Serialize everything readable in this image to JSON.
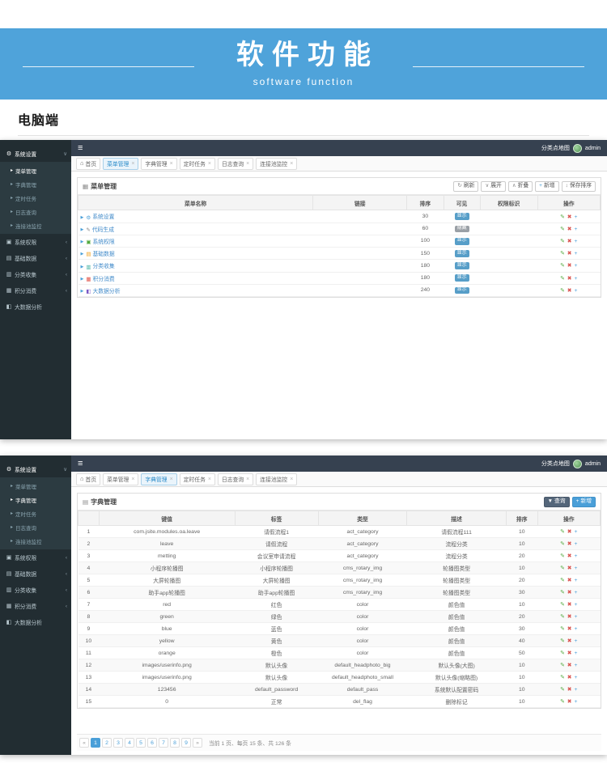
{
  "banner": {
    "title": "软件功能",
    "subtitle": "software function"
  },
  "section_label": "电脑端",
  "colors": {
    "accent": "#4a9fd8",
    "banner": "#4fa3da",
    "sidebar": "#222d32",
    "navbar": "#364150",
    "badge_show": "#579ec8",
    "badge_hide": "#9aa0a6"
  },
  "icons": {
    "hamburger": "≡",
    "home": "⌂",
    "close": "×",
    "caret_right": "▸",
    "chevron_down": "∨",
    "tree": "▶",
    "edit": "✎",
    "delete": "✖",
    "add": "+",
    "box_title1": "▦",
    "box_title2": "▤"
  },
  "navbar": {
    "map_link": "分类点地图",
    "user": "admin"
  },
  "sidebar": {
    "items": [
      {
        "label": "系统设置",
        "glyph": "⚙",
        "icon": "gear-icon",
        "expanded": true,
        "children": [
          "菜单管理",
          "字典管理",
          "定时任务",
          "日志查询",
          "连接池监控"
        ]
      },
      {
        "label": "系统权限",
        "glyph": "▣",
        "icon": "permission-icon",
        "arrow": "‹"
      },
      {
        "label": "基础数据",
        "glyph": "▤",
        "icon": "database-icon",
        "arrow": "‹"
      },
      {
        "label": "分类收集",
        "glyph": "▥",
        "icon": "collect-icon",
        "arrow": "‹"
      },
      {
        "label": "积分消费",
        "glyph": "▦",
        "icon": "points-icon",
        "arrow": "‹"
      },
      {
        "label": "大数据分析",
        "glyph": "◧",
        "icon": "analysis-icon",
        "arrow": ""
      }
    ]
  },
  "tabs": [
    {
      "label": "首页",
      "home": true
    },
    {
      "label": "菜单管理"
    },
    {
      "label": "字典管理"
    },
    {
      "label": "定时任务"
    },
    {
      "label": "日志查询"
    },
    {
      "label": "连接池监控"
    }
  ],
  "panel1": {
    "active_tab": "菜单管理",
    "active_side": "菜单管理",
    "box_title": "菜单管理",
    "toolbar": [
      {
        "label": "刷新",
        "glyph": "↻",
        "icon": "refresh-icon",
        "name": "refresh-button",
        "style": "default"
      },
      {
        "label": "展开",
        "glyph": "∨",
        "icon": "expand-icon",
        "name": "expand-button",
        "style": "default"
      },
      {
        "label": "折叠",
        "glyph": "∧",
        "icon": "collapse-icon",
        "name": "collapse-button",
        "style": "default"
      },
      {
        "label": "新增",
        "glyph": "+",
        "icon": "plus-icon",
        "name": "add-button",
        "style": "default",
        "icon_color": "#4a9fd8"
      },
      {
        "label": "保存排序",
        "glyph": "↕",
        "icon": "sort-icon",
        "name": "save-sort-button",
        "style": "default"
      }
    ],
    "headers": [
      "菜单名称",
      "链接",
      "排序",
      "可见",
      "权限标识",
      "操作"
    ],
    "rows": [
      {
        "name": "系统设置",
        "glyph": "⚙",
        "color": "#4a9fd8",
        "link": "",
        "sort": "30",
        "visible": "显示",
        "show": true,
        "perm": ""
      },
      {
        "name": "代码生成",
        "glyph": "✎",
        "color": "#8a8a8a",
        "link": "",
        "sort": "60",
        "visible": "隐藏",
        "show": false,
        "perm": ""
      },
      {
        "name": "系统权限",
        "glyph": "▣",
        "color": "#53a93f",
        "link": "",
        "sort": "100",
        "visible": "显示",
        "show": true,
        "perm": ""
      },
      {
        "name": "基础数据",
        "glyph": "▤",
        "color": "#f4a425",
        "link": "",
        "sort": "150",
        "visible": "显示",
        "show": true,
        "perm": ""
      },
      {
        "name": "分类收集",
        "glyph": "▥",
        "color": "#3bafa0",
        "link": "",
        "sort": "180",
        "visible": "显示",
        "show": true,
        "perm": ""
      },
      {
        "name": "积分消费",
        "glyph": "▦",
        "color": "#e2574c",
        "link": "",
        "sort": "180",
        "visible": "显示",
        "show": true,
        "perm": ""
      },
      {
        "name": "大数据分析",
        "glyph": "◧",
        "color": "#7a57c5",
        "link": "",
        "sort": "240",
        "visible": "显示",
        "show": true,
        "perm": ""
      }
    ]
  },
  "panel2": {
    "active_tab": "字典管理",
    "active_side": "字典管理",
    "box_title": "字典管理",
    "toolbar": [
      {
        "label": "查询",
        "glyph": "▼",
        "icon": "filter-icon",
        "name": "query-button",
        "style": "dark"
      },
      {
        "label": "新增",
        "glyph": "+",
        "icon": "plus-icon",
        "name": "add-button",
        "style": "primary"
      }
    ],
    "headers": [
      "",
      "键值",
      "标签",
      "类型",
      "描述",
      "排序",
      "操作"
    ],
    "rows": [
      [
        "1",
        "com.jsite.modules.oa.leave",
        "请假流程1",
        "act_category",
        "请假流程111",
        "10"
      ],
      [
        "2",
        "leave",
        "请假流程",
        "act_category",
        "流程分类",
        "10"
      ],
      [
        "3",
        "metting",
        "会议室申请流程",
        "act_category",
        "流程分类",
        "20"
      ],
      [
        "4",
        "小程序轮播图",
        "小程序轮播图",
        "cms_rotary_img",
        "轮播图类型",
        "10"
      ],
      [
        "5",
        "大屏轮播图",
        "大屏轮播图",
        "cms_rotary_img",
        "轮播图类型",
        "20"
      ],
      [
        "6",
        "助手app轮播图",
        "助手app轮播图",
        "cms_rotary_img",
        "轮播图类型",
        "30"
      ],
      [
        "7",
        "red",
        "红色",
        "color",
        "颜色值",
        "10"
      ],
      [
        "8",
        "green",
        "绿色",
        "color",
        "颜色值",
        "20"
      ],
      [
        "9",
        "blue",
        "蓝色",
        "color",
        "颜色值",
        "30"
      ],
      [
        "10",
        "yellow",
        "黄色",
        "color",
        "颜色值",
        "40"
      ],
      [
        "11",
        "orange",
        "橙色",
        "color",
        "颜色值",
        "50"
      ],
      [
        "12",
        "images/userinfo.png",
        "默认头像",
        "default_headphoto_big",
        "默认头像(大图)",
        "10"
      ],
      [
        "13",
        "images/userinfo.png",
        "默认头像",
        "default_headphoto_small",
        "默认头像(缩略图)",
        "10"
      ],
      [
        "14",
        "123456",
        "default_password",
        "default_pass",
        "系统默认配置密码",
        "10"
      ],
      [
        "15",
        "0",
        "正常",
        "del_flag",
        "删除标记",
        "10"
      ]
    ],
    "pagination": {
      "first": "«",
      "pages": [
        "1",
        "2",
        "3",
        "4",
        "5",
        "6",
        "7",
        "8",
        "9"
      ],
      "last": "»",
      "active": "1",
      "info": "当前 1 页、每页 15 条、共 126 条"
    }
  }
}
